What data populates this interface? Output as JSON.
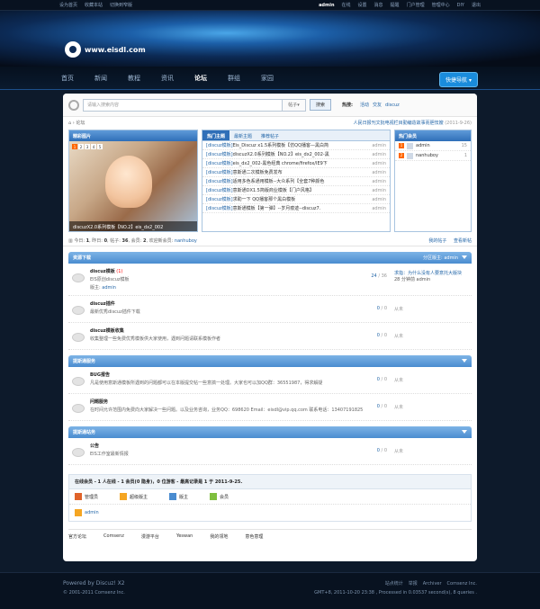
{
  "topbar": {
    "left": [
      "设为首页",
      "收藏本站",
      "切换到窄版"
    ],
    "user": "admin",
    "right": [
      "在线",
      "设置",
      "消息",
      "提醒",
      "门户管理",
      "管理中心",
      "DIY",
      "退出"
    ]
  },
  "logo": {
    "text": "www.eisdl.com"
  },
  "nav": {
    "items": [
      "首页",
      "新闻",
      "教程",
      "资讯",
      "论坛",
      "群组",
      "家园"
    ],
    "active_index": 4,
    "quick": "快捷导航"
  },
  "search": {
    "placeholder": "请输入搜索内容",
    "scope": "帖子",
    "button": "搜索",
    "hot_label": "热搜:",
    "hot": [
      "活动",
      "交友",
      "discuz"
    ]
  },
  "breadcrumb": {
    "current": "论坛",
    "news": "人民日报刊文批电视栏目勤编造故事而胆怯嫂",
    "news_date": "(2011-9-26)"
  },
  "featured": {
    "title": "精彩图片",
    "pages": [
      "1",
      "2",
      "3",
      "4",
      "5"
    ],
    "caption": "discuzX2.0系列模板【NO.2】eis_dx2_002"
  },
  "hot_tabs": {
    "tabs": [
      "热门主题",
      "最新主题",
      "推荐帖子"
    ],
    "items": [
      {
        "cat": "[discuz模板]",
        "title": "Eis_Discuz x1.5系列模板【仿QQ播客—黑白简",
        "user": "admin"
      },
      {
        "cat": "[discuz模板]",
        "title": "discuzX2.0系列模板【NO.2】eis_dx2_002-黑",
        "user": "admin"
      },
      {
        "cat": "[discuz模板]",
        "title": "eis_dx2_002-黑色经典 chrome/firefox/IE9下",
        "user": "admin"
      },
      {
        "cat": "[discuz模板]",
        "title": "意斯通二次模板免费发布",
        "user": "admin"
      },
      {
        "cat": "[discuz模板]",
        "title": "适用多色系通用模板--大众系列【全套7种颜色",
        "user": "admin"
      },
      {
        "cat": "[discuz模板]",
        "title": "意斯通DX1.5简版商业模板【门户风格】",
        "user": "admin"
      },
      {
        "cat": "[discuz模板]",
        "title": "求助一下 QQ播客那个黑白模板",
        "user": "admin"
      },
      {
        "cat": "[discuz模板]",
        "title": "意斯通模板【第一弹】--岁月痕迹--discuz7.",
        "user": "admin"
      }
    ]
  },
  "hot_members": {
    "title": "热门会员",
    "items": [
      {
        "rank": "1",
        "name": "admin",
        "count": "15"
      },
      {
        "rank": "2",
        "name": "nanhuboy",
        "count": "1"
      }
    ]
  },
  "stats": {
    "today_label": "今日:",
    "today": "1",
    "yesterday_label": "昨日:",
    "yesterday": "0",
    "posts_label": "帖子:",
    "posts": "36",
    "members_label": "会员:",
    "members": "2",
    "welcome_label": "欢迎新会员:",
    "newest": "nanhuboy",
    "my_posts": "我的帖子",
    "new_posts": "查看新帖"
  },
  "sections": [
    {
      "title": "资源下载",
      "mod_label": "分区版主:",
      "mod": "admin",
      "forums": [
        {
          "name": "discuz模板",
          "badge": "(1)",
          "desc": "EIS原创discuz模板",
          "mod_label": "版主:",
          "mod": "admin",
          "topics": "24",
          "posts": "36",
          "last_title": "求指：为什么没有人要意托大版块",
          "last_time": "28 分钟前",
          "last_user": "admin"
        },
        {
          "name": "discuz插件",
          "badge": "",
          "desc": "最新优秀discuz插件下载",
          "mod_label": "",
          "mod": "",
          "topics": "0",
          "posts": "0",
          "last_title": "从未",
          "last_time": "",
          "last_user": ""
        },
        {
          "name": "discuz模板收集",
          "badge": "",
          "desc": "收集整理一些免费优秀模板供大家使用，遇到问题请联系模板作者",
          "mod_label": "",
          "mod": "",
          "topics": "0",
          "posts": "0",
          "last_title": "从未",
          "last_time": "",
          "last_user": ""
        }
      ]
    },
    {
      "title": "提斯通服务",
      "mod_label": "",
      "mod": "",
      "forums": [
        {
          "name": "BUG报告",
          "badge": "",
          "desc": "凡是使用意斯通模板所遇到的问题都可以在本版提交帖一些意搞一处理。大家也可以加QQ群：36551987，得求解疑",
          "mod_label": "",
          "mod": "",
          "topics": "0",
          "posts": "0",
          "last_title": "从未",
          "last_time": "",
          "last_user": ""
        },
        {
          "name": "问题服务",
          "badge": "",
          "desc": "在时间允许范围内免费向大家解决一些问题。以及业务咨询，业务QQ：698620 Email：eisdl@vip.qq.com 联系电话：13407191825",
          "mod_label": "",
          "mod": "",
          "topics": "0",
          "posts": "0",
          "last_title": "从未",
          "last_time": "",
          "last_user": ""
        }
      ]
    },
    {
      "title": "提斯通站务",
      "mod_label": "",
      "mod": "",
      "forums": [
        {
          "name": "公告",
          "badge": "",
          "desc": "EIS工作室最新情报",
          "mod_label": "",
          "mod": "",
          "topics": "0",
          "posts": "0",
          "last_title": "从未",
          "last_time": "",
          "last_user": ""
        }
      ]
    }
  ],
  "online": {
    "summary": "在线会员 - 1 人在线 - 1 会员(0 隐身)，0 位游客 - 最高记录是 1 于 2011-9-25.",
    "legend": [
      {
        "label": "管理员",
        "color": "#e0632a"
      },
      {
        "label": "超级版主",
        "color": "#f5a623"
      },
      {
        "label": "版主",
        "color": "#4a8cd0"
      },
      {
        "label": "会员",
        "color": "#7fbf3f"
      }
    ],
    "users": [
      "admin"
    ]
  },
  "links": [
    "官方论坛",
    "Comsenz",
    "漫游平台",
    "Yeswan",
    "我的领地",
    "意色意理"
  ],
  "footer": {
    "powered": "Powered by Discuz! X2",
    "copyright": "© 2001-2011 Comsenz Inc.",
    "links": [
      "站点统计",
      "举报",
      "Archiver",
      "Comsenz Inc."
    ],
    "timing": "GMT+8, 2011-10-20 23:38 , Processed in 0.03537 second(s), 8 queries ."
  }
}
